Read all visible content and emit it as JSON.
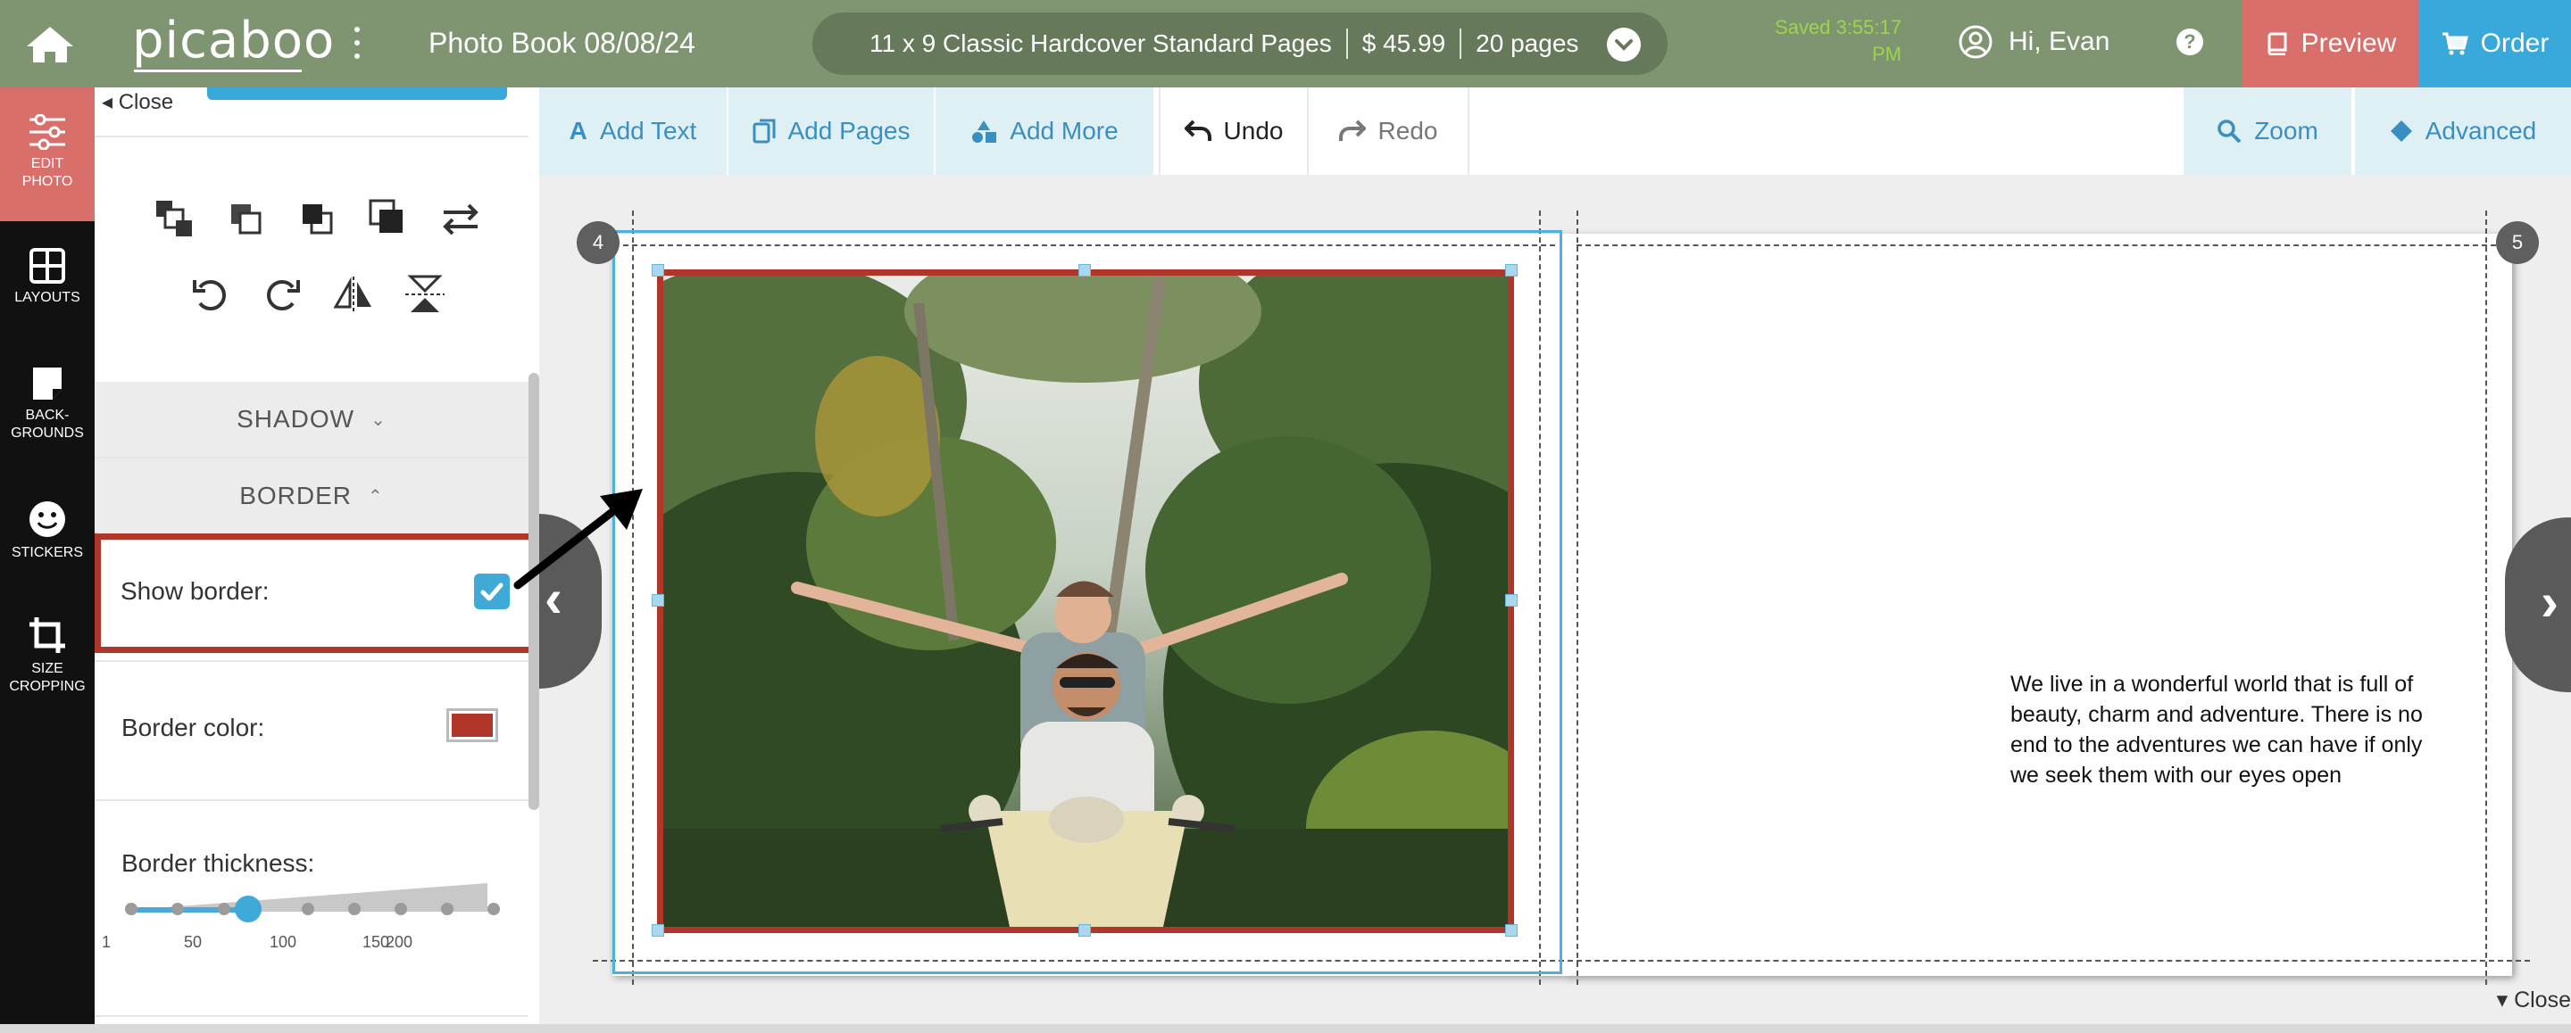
{
  "topbar": {
    "logo": "picaboo",
    "book_title": "Photo Book 08/08/24",
    "product": "11 x 9 Classic Hardcover Standard Pages",
    "price": "$ 45.99",
    "pages": "20 pages",
    "saved_line1": "Saved 3:55:17",
    "saved_line2": "PM",
    "greeting": "Hi, Evan",
    "help": "?",
    "preview_label": "Preview",
    "order_label": "Order"
  },
  "rail": {
    "items": [
      {
        "label1": "EDIT",
        "label2": "PHOTO",
        "icon": "sliders-icon"
      },
      {
        "label1": "LAYOUTS",
        "label2": "",
        "icon": "layouts-icon"
      },
      {
        "label1": "BACK-",
        "label2": "GROUNDS",
        "icon": "background-icon"
      },
      {
        "label1": "STICKERS",
        "label2": "",
        "icon": "smiley-icon"
      },
      {
        "label1": "SIZE",
        "label2": "CROPPING",
        "icon": "crop-icon"
      }
    ]
  },
  "panel": {
    "close_label": "Close",
    "shadow_label": "SHADOW",
    "border_label": "BORDER",
    "show_border_label": "Show border:",
    "show_border_checked": true,
    "border_color_label": "Border color:",
    "border_color": "#b03629",
    "border_thickness_label": "Border thickness:",
    "thickness_ticks": [
      "1",
      "50",
      "100",
      "150",
      "200"
    ],
    "thickness_value_fraction": 0.32
  },
  "toolbar": {
    "add_text": "Add Text",
    "add_pages": "Add Pages",
    "add_more": "Add More",
    "undo": "Undo",
    "redo": "Redo",
    "zoom": "Zoom",
    "advanced": "Advanced"
  },
  "canvas": {
    "left_page_number": "4",
    "right_page_number": "5",
    "caption": "We live in a wonderful world that is full of beauty, charm and adventure. There is no end to the adventures we can have if only we seek them with our eyes open",
    "close_label": "Close"
  },
  "colors": {
    "topbar": "#7f9470",
    "accent_blue": "#39a9dc",
    "preview_red": "#d96f6b",
    "border_red": "#b03629",
    "saved_green": "#9bd649"
  }
}
